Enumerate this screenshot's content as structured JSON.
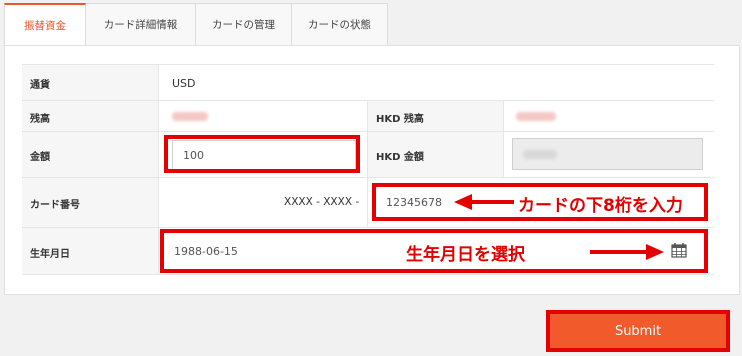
{
  "tabs": [
    {
      "label": "振替資金",
      "active": true
    },
    {
      "label": "カード詳細情報",
      "active": false
    },
    {
      "label": "カードの管理",
      "active": false
    },
    {
      "label": "カードの状態",
      "active": false
    }
  ],
  "form": {
    "currency_label": "通貨",
    "currency_value": "USD",
    "balance_label": "残高",
    "hkd_balance_label": "HKD 残高",
    "amount_label": "金額",
    "amount_value": "100",
    "hkd_amount_label": "HKD 金額",
    "card_number_label": "カード番号",
    "card_number_prefix": "XXXX - XXXX -",
    "card_number_value": "12345678",
    "birthdate_label": "生年月日",
    "birthdate_value": "1988-06-15"
  },
  "annotations": {
    "card_hint": "カードの下8桁を入力",
    "birthdate_hint": "生年月日を選択"
  },
  "submit_label": "Submit",
  "colors": {
    "accent": "#f15a2b",
    "annotation_red": "#e40000",
    "active_tab": "#e8562a"
  },
  "icons": {
    "calendar": "calendar-icon",
    "arrow": "arrow-left-icon"
  }
}
